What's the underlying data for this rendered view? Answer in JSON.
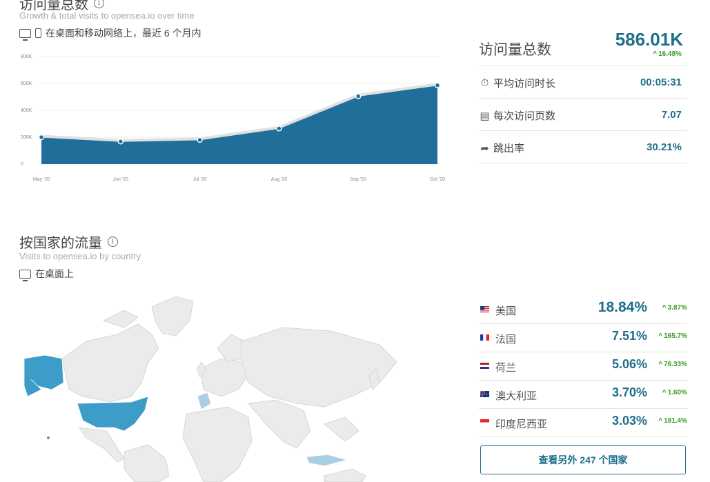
{
  "visits": {
    "title": "访问量总数",
    "subtitle": "Growth & total visits to opensea.io over time",
    "device_note": "在桌面和移动网络上，最近 6 个月内"
  },
  "metrics": {
    "total": {
      "label": "访问量总数",
      "value": "586.01K",
      "delta": "16.48%"
    },
    "rows": [
      {
        "label": "平均访问时长",
        "value": "00:05:31",
        "icon": "timer-icon"
      },
      {
        "label": "每次访问页数",
        "value": "7.07",
        "icon": "pages-icon"
      },
      {
        "label": "跳出率",
        "value": "30.21%",
        "icon": "bounce-arrow-icon"
      }
    ]
  },
  "chart_data": {
    "type": "area",
    "categories": [
      "May '20",
      "Jun '20",
      "Jul '20",
      "Aug '20",
      "Sep '20",
      "Oct '20"
    ],
    "values": [
      200000,
      168000,
      180000,
      265000,
      505000,
      586010
    ],
    "ylim": [
      0,
      800000
    ],
    "yticks": [
      "800K",
      "600K",
      "400K",
      "200K",
      "0"
    ],
    "grid": true,
    "color": "#1f6f9a"
  },
  "country_section": {
    "title": "按国家的流量",
    "subtitle": "Visits to opensea.io by country",
    "device_note": "在桌面上"
  },
  "countries": [
    {
      "name": "美国",
      "pct": "18.84%",
      "delta": "3.87%"
    },
    {
      "name": "法国",
      "pct": "7.51%",
      "delta": "165.7%"
    },
    {
      "name": "荷兰",
      "pct": "5.06%",
      "delta": "76.33%"
    },
    {
      "name": "澳大利亚",
      "pct": "3.70%",
      "delta": "1.60%"
    },
    {
      "name": "印度尼西亚",
      "pct": "3.03%",
      "delta": "181.4%"
    }
  ],
  "more_button": "查看另外 247 个国家",
  "colors": {
    "accent": "#1f6f8b",
    "positive": "#3a9d23",
    "map_highlight": "#3d9cc8",
    "map_light": "#a9cfe6",
    "map_land": "#ebebeb"
  }
}
